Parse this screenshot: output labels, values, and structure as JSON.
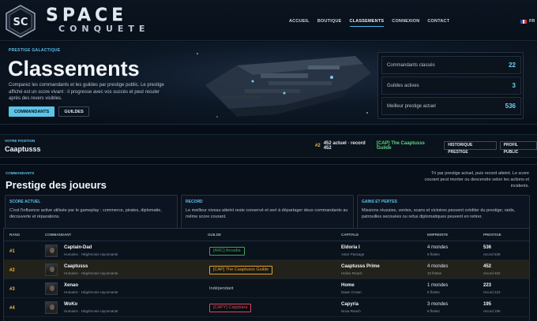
{
  "header": {
    "logo_title": "SPACE",
    "logo_subtitle": "CONQUETE",
    "nav": [
      {
        "label": "ACCUEIL",
        "active": false
      },
      {
        "label": "BOUTIQUE",
        "active": false
      },
      {
        "label": "CLASSEMENTS",
        "active": true
      },
      {
        "label": "CONNEXION",
        "active": false
      },
      {
        "label": "CONTACT",
        "active": false
      }
    ],
    "lang": "FR"
  },
  "hero": {
    "eyebrow": "PRESTIGE GALACTIQUE",
    "title": "Classements",
    "description": "Comparez les commandants et les guildes par prestige public. Le prestige affiché est un score vivant : il progresse avec vos succès et peut reculer après des revers visibles.",
    "buttons": {
      "commandants": "COMMANDANTS",
      "guildes": "GUILDES"
    },
    "stats": [
      {
        "label": "Commandants classés",
        "value": "22"
      },
      {
        "label": "Guildes actives",
        "value": "3"
      },
      {
        "label": "Meilleur prestige actuel",
        "value": "536"
      }
    ]
  },
  "position": {
    "eyebrow": "VOTRE POSITION",
    "name": "Caaptusss",
    "rank": "#2",
    "score": "452 actuel · record 452",
    "guild": "[CAP] The Caaptusss Guilde",
    "history_button": "HISTORIQUE PRESTIGE",
    "profile_button": "PROFIL PUBLIC"
  },
  "prestige": {
    "eyebrow": "COMMANDANTS",
    "title": "Prestige des joueurs",
    "note": "Tri par prestige actuel, puis record atteint. Le score courant peut monter ou descendre selon les actions et incidents.",
    "cards": [
      {
        "title": "SCORE ACTUEL",
        "text": "C'est l'influence active utilisée par le gameplay : commerce, pirates, diplomatie, découverte et réparations."
      },
      {
        "title": "RECORD",
        "text": "Le meilleur niveau atteint reste conservé et sert à départager deux commandants au même score courant."
      },
      {
        "title": "GAINS ET PERTES",
        "text": "Missions réussies, ventes, scans et victoires peuvent créditer du prestige; raids, patrouilles secouées ou refus diplomatiques peuvent en retirer."
      }
    ],
    "columns": [
      "RANG",
      "COMMANDANT",
      "GUILDE",
      "CAPITALE",
      "EMPREINTE",
      "PRESTIGE"
    ],
    "rows": [
      {
        "rank": "#1",
        "name": "Captain-Dad",
        "faction": "Humains · Hégémonie rayonnante",
        "guild": "[ARC] Arcadia",
        "guild_color": "#3fa45a",
        "guild_style": "tag",
        "capital": "Eldoria I",
        "capital_sub": "Aster Passage",
        "footprint": "4 mondes",
        "footprint_sub": "9 flottes",
        "prestige": "536",
        "record": "record 536",
        "highlight": false
      },
      {
        "rank": "#2",
        "name": "Caaptusss",
        "faction": "Humains · Hégémonie rayonnante",
        "guild": "[CAP] The Caaptusss Guilde",
        "guild_color": "#e0a238",
        "guild_style": "tag",
        "capital": "Caaptusss Prime",
        "capital_sub": "Helios Reach",
        "footprint": "4 mondes",
        "footprint_sub": "10 flottes",
        "prestige": "452",
        "record": "record 452",
        "highlight": true
      },
      {
        "rank": "#3",
        "name": "Xenao",
        "faction": "Humains · Hégémonie rayonnante",
        "guild": "Indépendant",
        "guild_color": "#b8c4d1",
        "guild_style": "plain",
        "capital": "Home",
        "capital_sub": "Dawn Crown",
        "footprint": "1 mondes",
        "footprint_sub": "5 flottes",
        "prestige": "223",
        "record": "record 223",
        "highlight": false
      },
      {
        "rank": "#4",
        "name": "WoKo",
        "faction": "Humains · Hégémonie rayonnante",
        "guild": "[CAPY] Capybara",
        "guild_color": "#d9485a",
        "guild_style": "tag",
        "capital": "Capyria",
        "capital_sub": "Nova Reach",
        "footprint": "3 mondes",
        "footprint_sub": "6 flottes",
        "prestige": "195",
        "record": "record 195",
        "highlight": false
      }
    ]
  }
}
